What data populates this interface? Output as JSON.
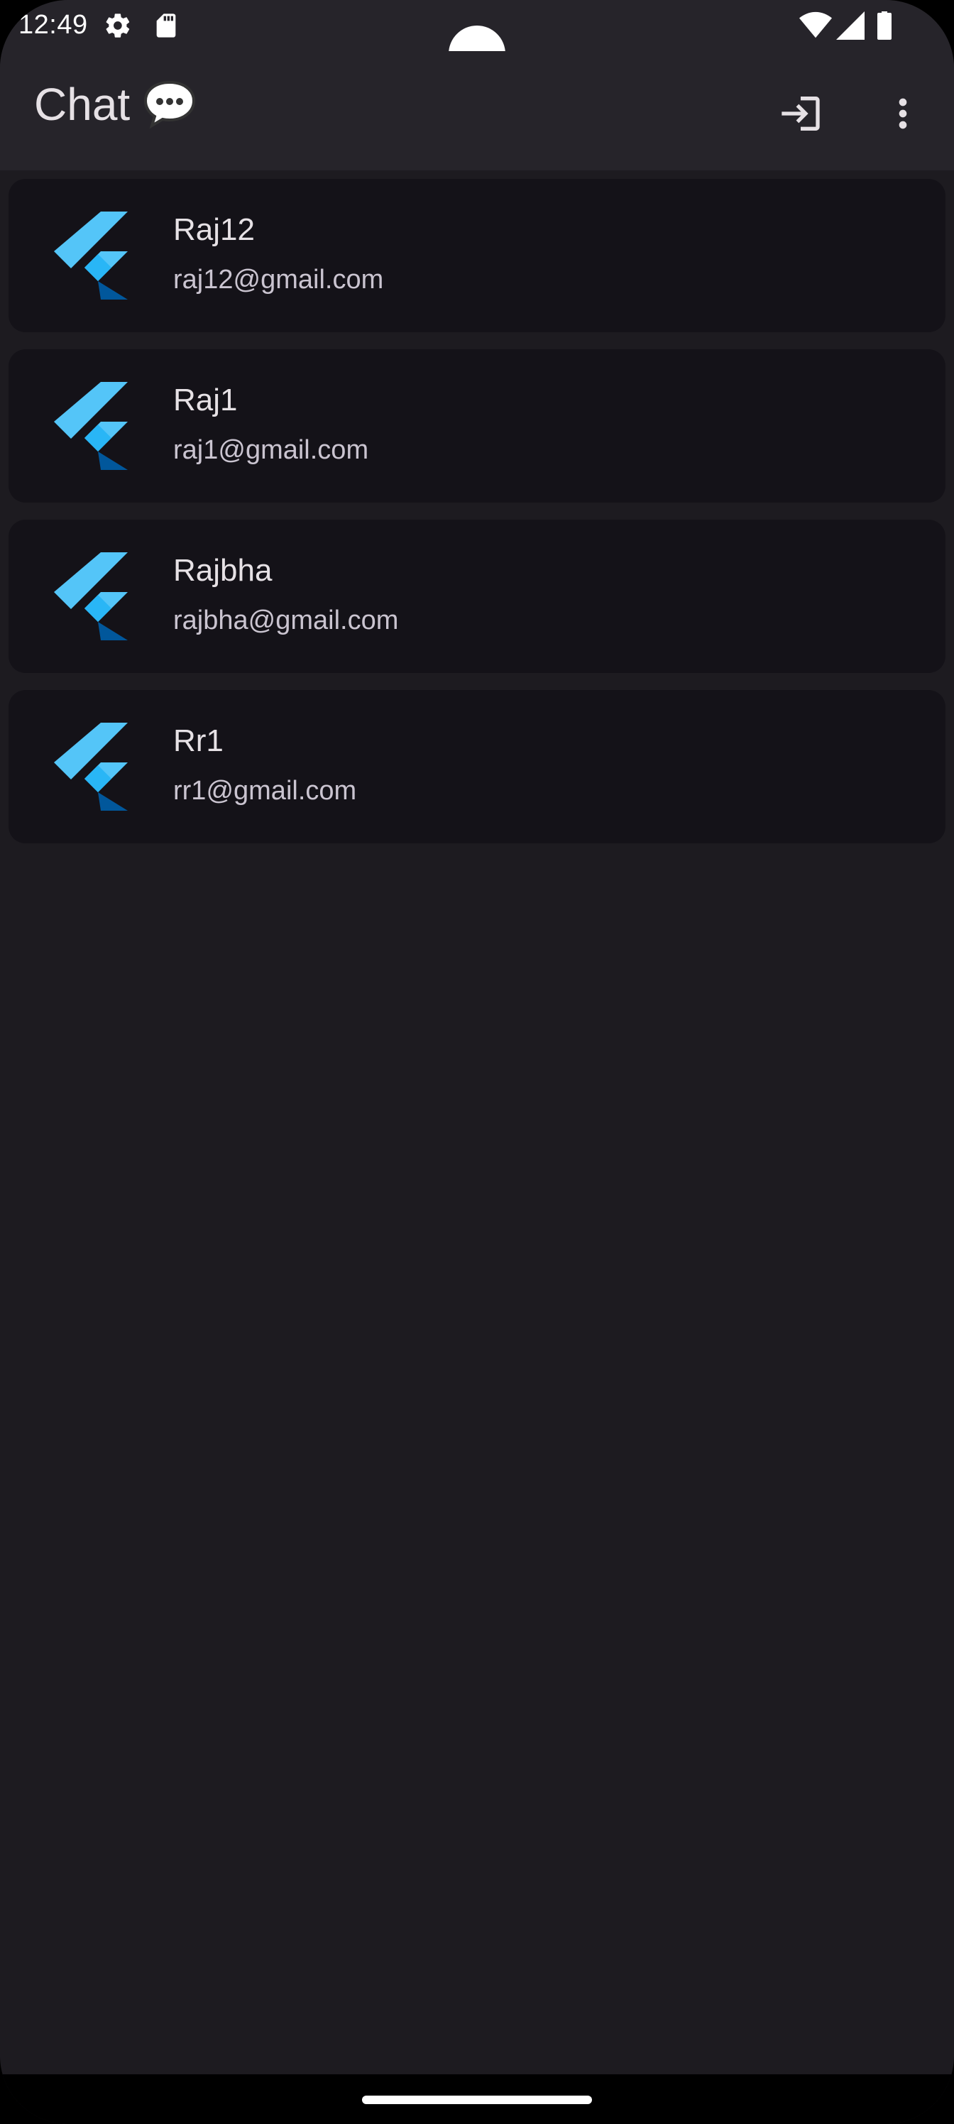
{
  "status_bar": {
    "time": "12:49",
    "icons": [
      "settings-icon",
      "sd-card-icon",
      "wifi-icon",
      "cellular-signal-icon",
      "battery-icon"
    ]
  },
  "app_bar": {
    "title": "Chat",
    "title_icon": "speech-balloon-icon",
    "actions": [
      "login-icon",
      "more-vert-icon"
    ]
  },
  "users": [
    {
      "name": "Raj12",
      "email": "raj12@gmail.com",
      "avatar": "flutter-logo-icon"
    },
    {
      "name": "Raj1",
      "email": "raj1@gmail.com",
      "avatar": "flutter-logo-icon"
    },
    {
      "name": "Rajbha",
      "email": "rajbha@gmail.com",
      "avatar": "flutter-logo-icon"
    },
    {
      "name": "Rr1",
      "email": "rr1@gmail.com",
      "avatar": "flutter-logo-icon"
    }
  ],
  "colors": {
    "background": "#1d1b20",
    "app_bar": "#26242a",
    "card": "#141218",
    "primary_text": "#e6e1e5",
    "secondary_text": "#cac4d0",
    "flutter_light_blue": "#54c5f8",
    "flutter_dark_blue": "#01579b"
  }
}
